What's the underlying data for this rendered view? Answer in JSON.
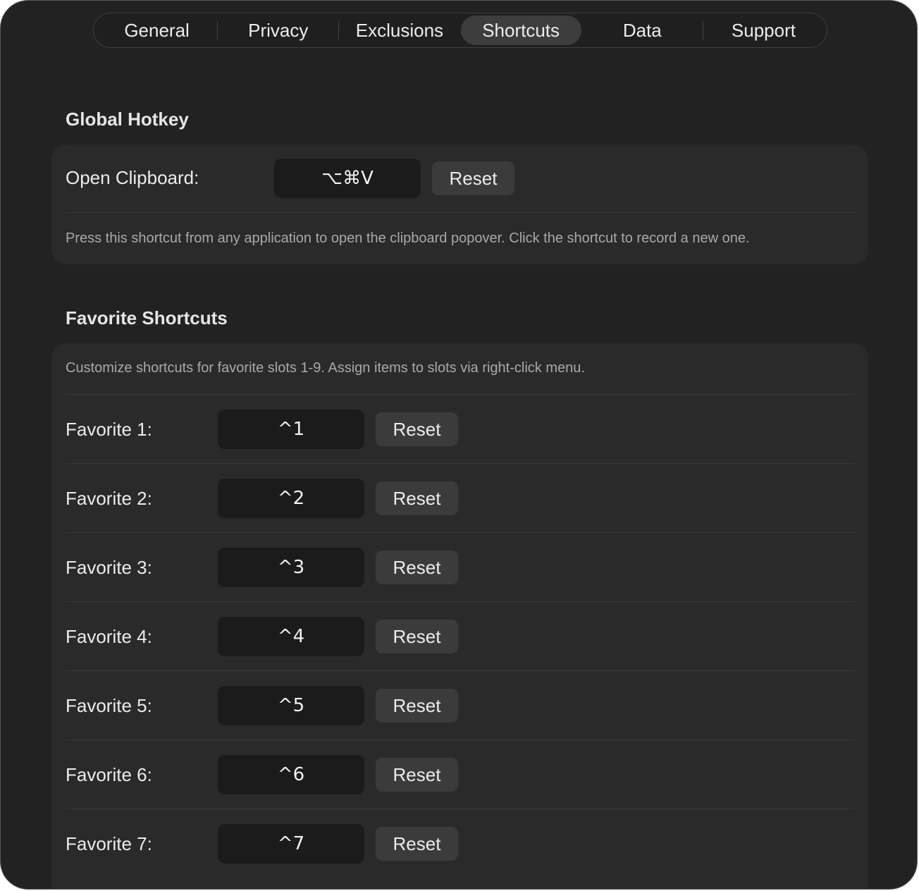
{
  "tabs": [
    {
      "label": "General",
      "active": false
    },
    {
      "label": "Privacy",
      "active": false
    },
    {
      "label": "Exclusions",
      "active": false
    },
    {
      "label": "Shortcuts",
      "active": true
    },
    {
      "label": "Data",
      "active": false
    },
    {
      "label": "Support",
      "active": false
    }
  ],
  "global_hotkey": {
    "title": "Global Hotkey",
    "label": "Open Clipboard:",
    "shortcut": "⌥⌘V",
    "reset_label": "Reset",
    "description": "Press this shortcut from any application to open the clipboard popover. Click the shortcut to record a new one."
  },
  "favorites": {
    "title": "Favorite Shortcuts",
    "description": "Customize shortcuts for favorite slots 1-9. Assign items to slots via right-click menu.",
    "reset_label": "Reset",
    "items": [
      {
        "label": "Favorite 1:",
        "shortcut": "^1"
      },
      {
        "label": "Favorite 2:",
        "shortcut": "^2"
      },
      {
        "label": "Favorite 3:",
        "shortcut": "^3"
      },
      {
        "label": "Favorite 4:",
        "shortcut": "^4"
      },
      {
        "label": "Favorite 5:",
        "shortcut": "^5"
      },
      {
        "label": "Favorite 6:",
        "shortcut": "^6"
      },
      {
        "label": "Favorite 7:",
        "shortcut": "^7"
      }
    ]
  }
}
